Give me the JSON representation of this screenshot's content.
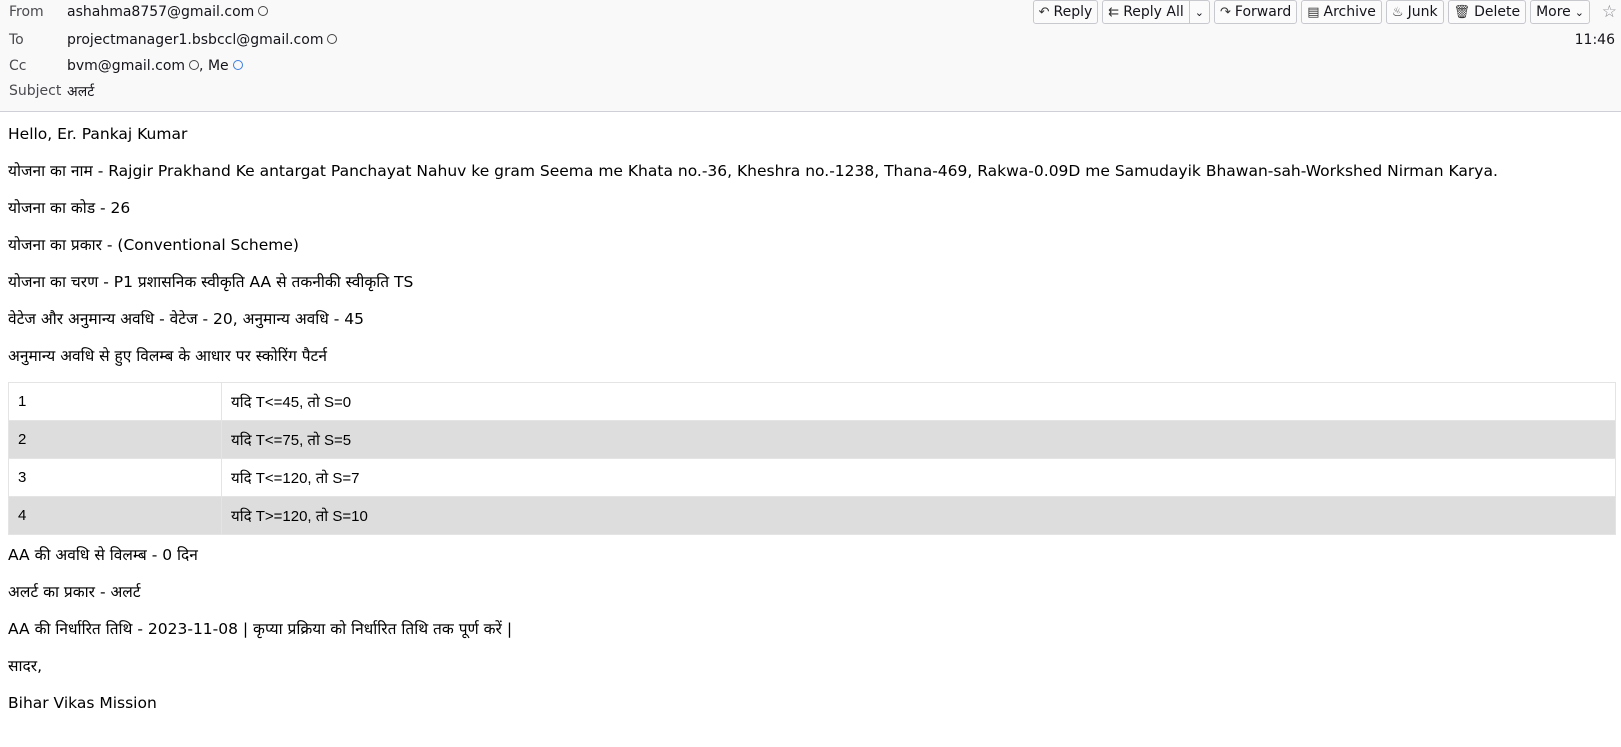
{
  "header": {
    "from_label": "From",
    "from_value": "ashahma8757@gmail.com",
    "to_label": "To",
    "to_value": "projectmanager1.bsbccl@gmail.com",
    "cc_label": "Cc",
    "cc_value": "bvm@gmail.com",
    "cc_me": ", Me",
    "subject_label": "Subject",
    "subject_value": "अलर्ट",
    "time": "11:46"
  },
  "toolbar": {
    "reply": "Reply",
    "reply_all": "Reply All",
    "forward": "Forward",
    "archive": "Archive",
    "junk": "Junk",
    "delete": "Delete",
    "more": "More"
  },
  "body": {
    "greeting": "Hello, Er. Pankaj Kumar",
    "scheme_name": "योजना का नाम - Rajgir Prakhand Ke antargat Panchayat Nahuv ke gram Seema me Khata no.-36, Kheshra no.-1238, Thana-469, Rakwa-0.09D me Samudayik Bhawan-sah-Workshed Nirman Karya.",
    "scheme_code": "योजना का कोड - 26",
    "scheme_type": "योजना का प्रकार - (Conventional Scheme)",
    "scheme_stage": "योजना का चरण - P1 प्रशासनिक स्वीकृति AA से तकनीकी स्वीकृति TS",
    "weightage": "वेटेज और अनुमान्य अवधि - वेटेज - 20, अनुमान्य अवधि - 45",
    "scoring_heading": "अनुमान्य अवधि से हुए विलम्ब के आधार पर स्कोरिंग पैटर्न",
    "scoring_rows": [
      {
        "num": "1",
        "rule": "यदि T<=45, तो S=0"
      },
      {
        "num": "2",
        "rule": "यदि T<=75, तो S=5"
      },
      {
        "num": "3",
        "rule": "यदि T<=120, तो S=7"
      },
      {
        "num": "4",
        "rule": "यदि T>=120, तो S=10"
      }
    ],
    "delay": "AA की अवधि से विलम्ब - 0 दिन",
    "alert_type": "अलर्ट का प्रकार - अलर्ट",
    "due_date": "AA की निर्धारित तिथि - 2023-11-08 | कृप्या प्रक्रिया को निर्धारित तिथि तक पूर्ण करें |",
    "regards": "सादर,",
    "signature": "Bihar Vikas Mission"
  }
}
